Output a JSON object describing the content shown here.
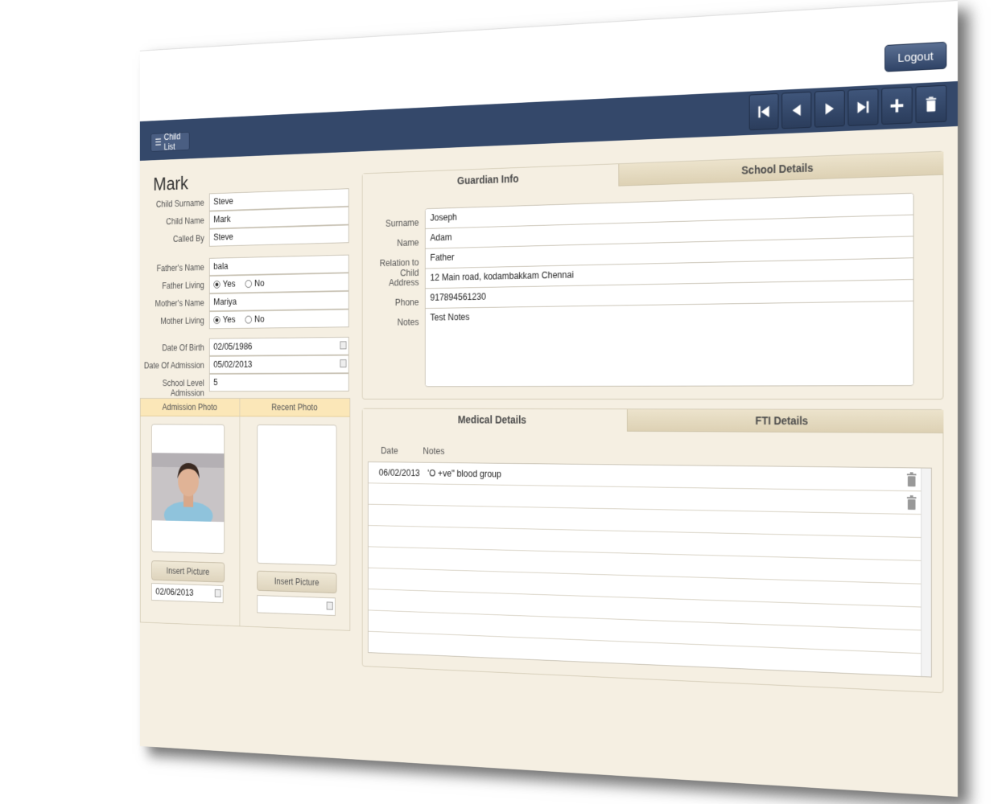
{
  "header": {
    "logout_label": "Logout",
    "child_list_label": "Child List"
  },
  "nav": {
    "icons": [
      "first-icon",
      "prev-icon",
      "next-icon",
      "last-icon",
      "add-icon",
      "delete-icon"
    ]
  },
  "child_display_name": "Mark",
  "child_form": {
    "surname_label": "Child Surname",
    "surname": "Steve",
    "name_label": "Child Name",
    "name": "Mark",
    "called_by_label": "Called By",
    "called_by": "Steve",
    "father_name_label": "Father's Name",
    "father_name": "bala",
    "father_living_label": "Father Living",
    "mother_name_label": "Mother's Name",
    "mother_name": "Mariya",
    "mother_living_label": "Mother Living",
    "yes": "Yes",
    "no": "No",
    "dob_label": "Date Of Birth",
    "dob": "02/05/1986",
    "doa_label": "Date Of Admission",
    "doa": "05/02/2013",
    "school_level_label": "School Level Admission",
    "school_level": "5"
  },
  "photos": {
    "admission_title": "Admission Photo",
    "recent_title": "Recent Photo",
    "insert_label": "Insert Picture",
    "admission_date": "02/06/2013",
    "recent_date": ""
  },
  "guardian_tabs": {
    "active": "Guardian Info",
    "inactive": "School Details"
  },
  "guardian": {
    "surname_label": "Surname",
    "surname": "Joseph",
    "name_label": "Name",
    "name": "Adam",
    "relation_label": "Relation to Child",
    "relation": "Father",
    "address_label": "Address",
    "address": "12 Main road, kodambakkam Chennai",
    "phone_label": "Phone",
    "phone": "917894561230",
    "notes_label": "Notes",
    "notes": "Test Notes"
  },
  "medical_tabs": {
    "active": "Medical Details",
    "inactive": "FTI Details"
  },
  "medical": {
    "col_date": "Date",
    "col_notes": "Notes",
    "rows": [
      {
        "date": "06/02/2013",
        "notes": "'O +ve\" blood group"
      },
      {
        "date": "",
        "notes": ""
      }
    ]
  }
}
